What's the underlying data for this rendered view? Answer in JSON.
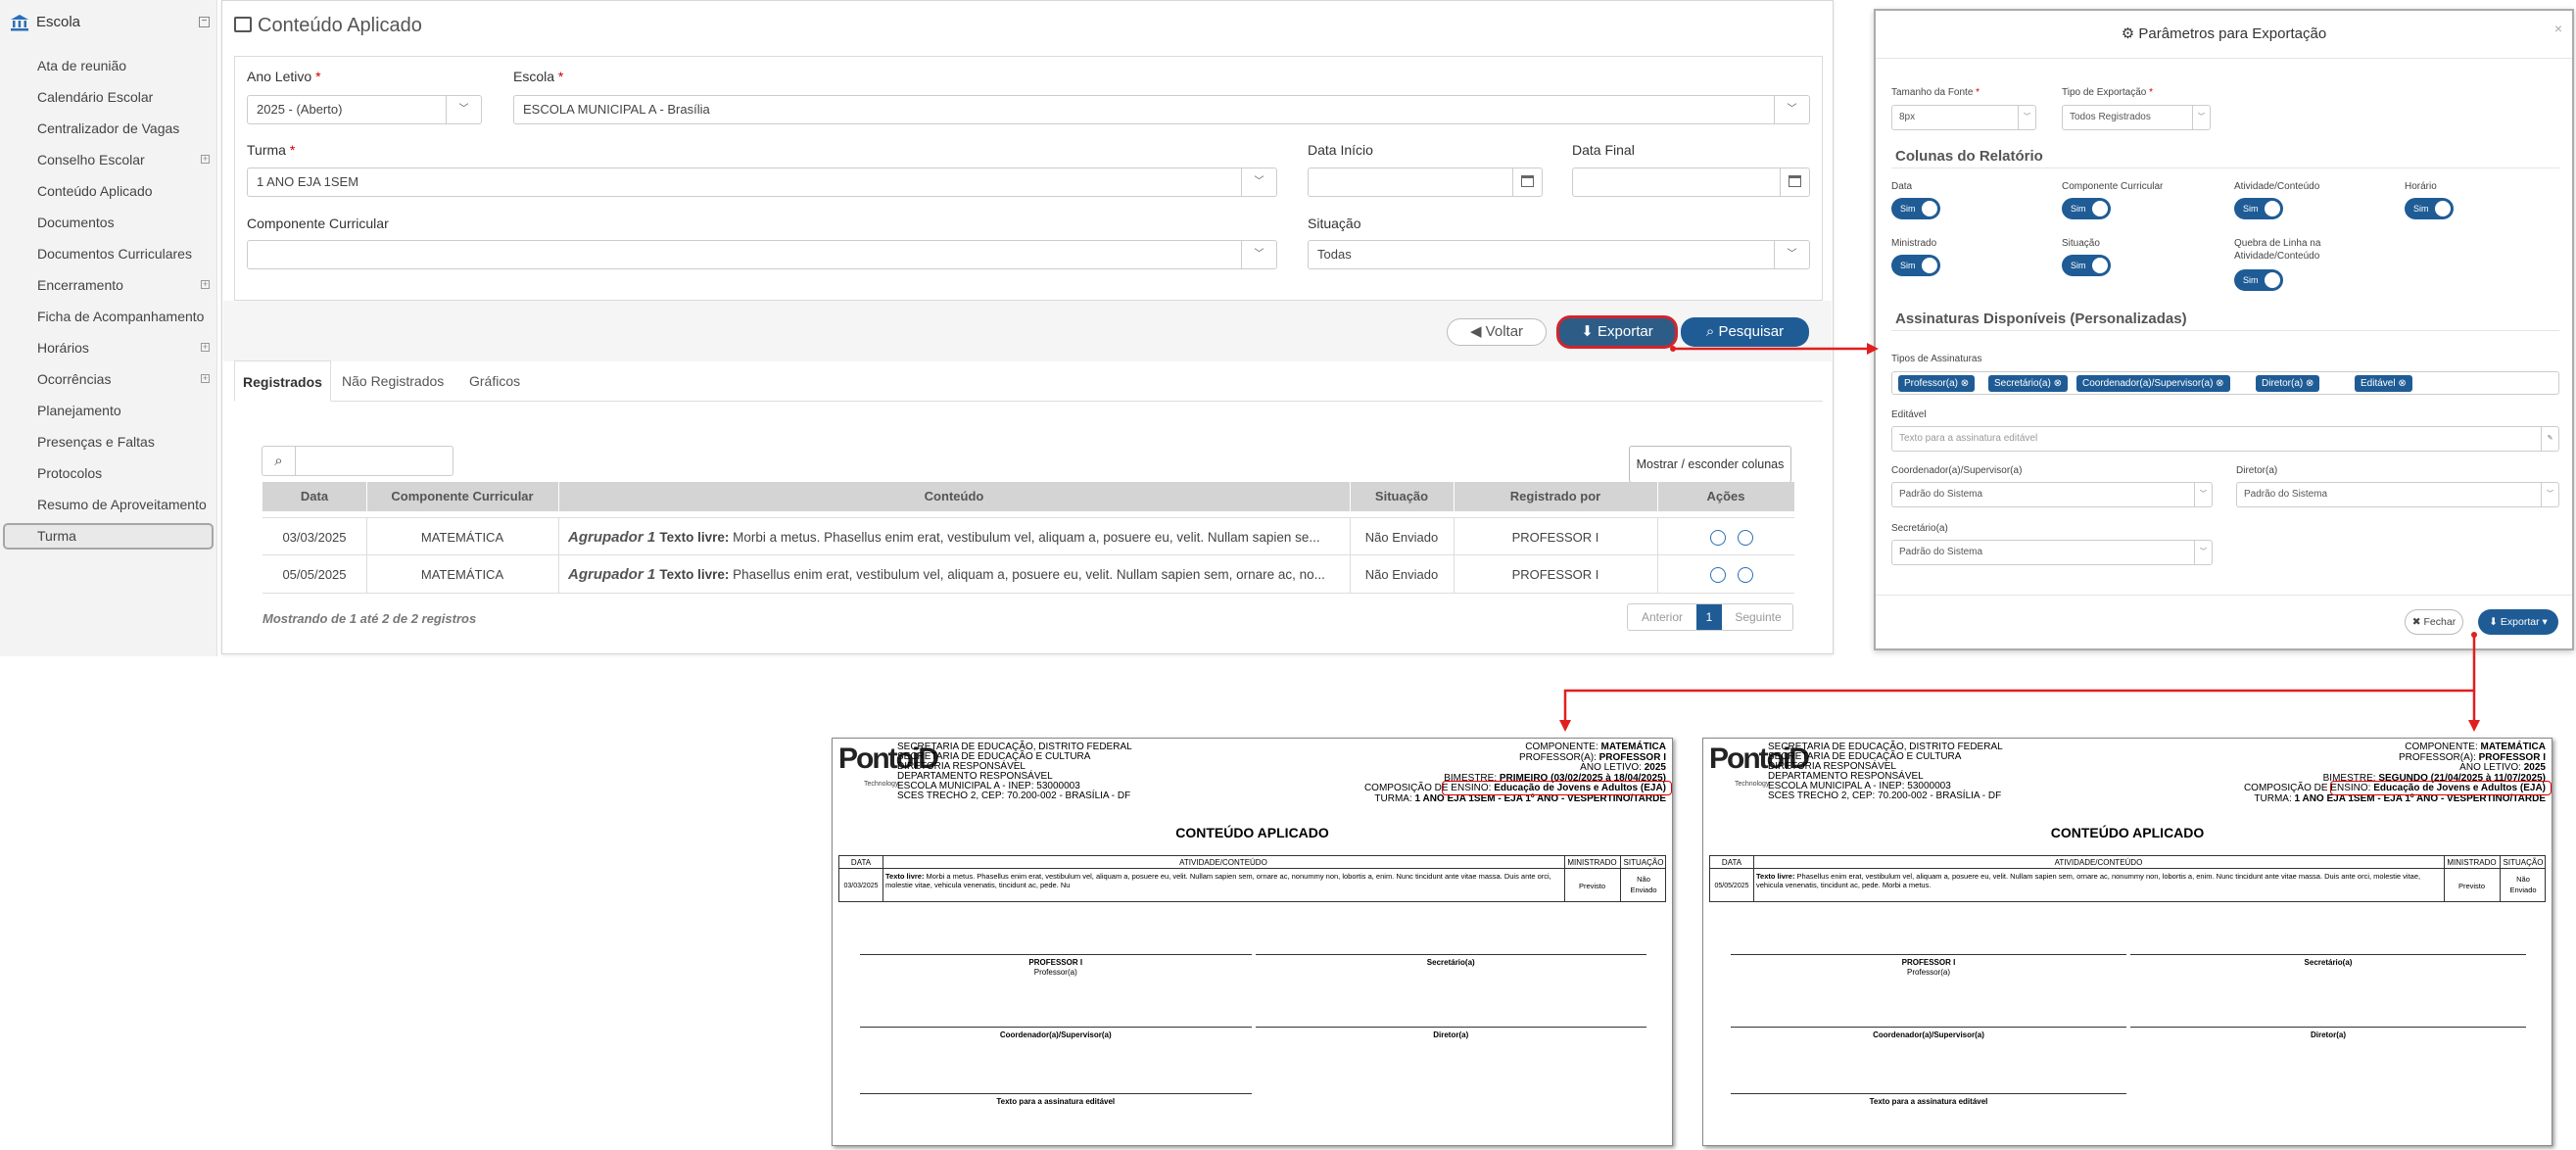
{
  "sidebar": {
    "header": "Escola",
    "items": [
      {
        "label": "Ata de reunião",
        "expandable": false
      },
      {
        "label": "Calendário Escolar",
        "expandable": false
      },
      {
        "label": "Centralizador de Vagas",
        "expandable": false
      },
      {
        "label": "Conselho Escolar",
        "expandable": true
      },
      {
        "label": "Conteúdo Aplicado",
        "expandable": false
      },
      {
        "label": "Documentos",
        "expandable": false
      },
      {
        "label": "Documentos Curriculares",
        "expandable": false
      },
      {
        "label": "Encerramento",
        "expandable": true
      },
      {
        "label": "Ficha de Acompanhamento",
        "expandable": false
      },
      {
        "label": "Horários",
        "expandable": true
      },
      {
        "label": "Ocorrências",
        "expandable": true
      },
      {
        "label": "Planejamento",
        "expandable": false
      },
      {
        "label": "Presenças e Faltas",
        "expandable": false
      },
      {
        "label": "Protocolos",
        "expandable": false
      },
      {
        "label": "Resumo de Aproveitamento",
        "expandable": false
      },
      {
        "label": "Turma",
        "expandable": false
      }
    ]
  },
  "main": {
    "title": "Conteúdo Aplicado",
    "form": {
      "ano_letivo_label": "Ano Letivo",
      "ano_letivo_value": "2025 - (Aberto)",
      "escola_label": "Escola",
      "escola_value": "ESCOLA MUNICIPAL A - Brasília",
      "turma_label": "Turma",
      "turma_value": "1 ANO EJA 1SEM",
      "data_inicio_label": "Data Início",
      "data_final_label": "Data Final",
      "componente_label": "Componente Curricular",
      "componente_value": "",
      "situacao_label": "Situação",
      "situacao_value": "Todas",
      "required_mark": "*"
    },
    "buttons": {
      "voltar": "Voltar",
      "exportar": "Exportar",
      "pesquisar": "Pesquisar"
    },
    "tabs": [
      "Registrados",
      "Não Registrados",
      "Gráficos"
    ],
    "toggle_columns": "Mostrar / esconder colunas",
    "table": {
      "headers": [
        "Data",
        "Componente Curricular",
        "Conteúdo",
        "Situação",
        "Registrado por",
        "Ações"
      ],
      "rows": [
        {
          "data": "03/03/2025",
          "componente": "MATEMÁTICA",
          "agrupador": "Agrupador 1",
          "texto_label": "Texto livre:",
          "conteudo": "Morbi a metus. Phasellus enim erat, vestibulum vel, aliquam a, posuere eu, velit. Nullam sapien se...",
          "situacao": "Não Enviado",
          "registrado": "PROFESSOR I"
        },
        {
          "data": "05/05/2025",
          "componente": "MATEMÁTICA",
          "agrupador": "Agrupador 1",
          "texto_label": "Texto livre:",
          "conteudo": "Phasellus enim erat, vestibulum vel, aliquam a, posuere eu, velit. Nullam sapien sem, ornare ac, no...",
          "situacao": "Não Enviado",
          "registrado": "PROFESSOR I"
        }
      ]
    },
    "footer_info": "Mostrando de 1 até 2 de 2 registros",
    "pagination": {
      "prev": "Anterior",
      "current": "1",
      "next": "Seguinte"
    }
  },
  "dialog": {
    "title": "Parâmetros para Exportação",
    "close": "×",
    "tamanho_label": "Tamanho da Fonte",
    "tamanho_value": "8px",
    "tipo_label": "Tipo de Exportação",
    "tipo_value": "Todos Registrados",
    "colunas_heading": "Colunas do Relatório",
    "colunas": [
      {
        "label": "Data",
        "value": "Sim"
      },
      {
        "label": "Componente Curricular",
        "value": "Sim"
      },
      {
        "label": "Atividade/Conteúdo",
        "value": "Sim"
      },
      {
        "label": "Horário",
        "value": "Sim"
      },
      {
        "label": "Ministrado",
        "value": "Sim"
      },
      {
        "label": "Situação",
        "value": "Sim"
      },
      {
        "label": "Quebra de Linha na",
        "label2": "Atividade/Conteúdo",
        "value": "Sim"
      }
    ],
    "assinaturas_heading": "Assinaturas Disponíveis (Personalizadas)",
    "tipos_label": "Tipos de Assinaturas",
    "tags": [
      "Professor(a)",
      "Secretário(a)",
      "Coordenador(a)/Supervisor(a)",
      "Diretor(a)",
      "Editável"
    ],
    "editavel_label": "Editável",
    "editavel_placeholder": "Texto para a assinatura editável",
    "coord_label": "Coordenador(a)/Supervisor(a)",
    "coord_value": "Padrão do Sistema",
    "diretor_label": "Diretor(a)",
    "diretor_value": "Padrão do Sistema",
    "secretario_label": "Secretário(a)",
    "secretario_value": "Padrão do Sistema",
    "fechar": "Fechar",
    "exportar": "Exportar"
  },
  "reports": [
    {
      "logo": "PontoiD",
      "logo_sub": "Technology",
      "header_left": [
        "SECRETARIA DE EDUCAÇÃO, DISTRITO FEDERAL",
        "SECRETARIA DE EDUCAÇÃO E CULTURA",
        "DIRETORIA RESPONSÁVEL",
        "DEPARTAMENTO RESPONSÁVEL",
        "ESCOLA MUNICIPAL A - INEP: 53000003",
        "SCES TRECHO 2, CEP: 70.200-002 - BRASÍLIA - DF"
      ],
      "right": [
        {
          "k": "COMPONENTE:",
          "v": "MATEMÁTICA"
        },
        {
          "k": "PROFESSOR(A):",
          "v": "PROFESSOR I"
        },
        {
          "k": "ANO LETIVO:",
          "v": "2025"
        },
        {
          "k": "BIMESTRE:",
          "v": "PRIMEIRO (03/02/2025 à 18/04/2025)"
        },
        {
          "k": "COMPOSIÇÃO DE ENSINO:",
          "v": "Educação de Jovens e Adultos (EJA)"
        },
        {
          "k": "TURMA:",
          "v": "1 ANO EJA 1SEM - EJA 1º ANO - VESPERTINO/TARDE"
        }
      ],
      "title": "CONTEÚDO APLICADO",
      "cols": [
        "DATA",
        "ATIVIDADE/CONTEÚDO",
        "MINISTRADO",
        "SITUAÇÃO"
      ],
      "row": {
        "data": "03/03/2025",
        "label": "Texto livre:",
        "text": "Morbi a metus. Phasellus enim erat, vestibulum vel, aliquam a, posuere eu, velit. Nullam sapien sem, ornare ac, nonummy non, lobortis a, enim. Nunc tincidunt ante vitae massa. Duis ante orci, molestie vitae, vehicula venenatis, tincidunt ac, pede. Nu",
        "ministrado": "Previsto",
        "situacao1": "Não",
        "situacao2": "Enviado"
      },
      "sigs": {
        "prof_name": "PROFESSOR I",
        "prof": "Professor(a)",
        "sec": "Secretário(a)",
        "coord": "Coordenador(a)/Supervisor(a)",
        "dir": "Diretor(a)",
        "edit": "Texto para a assinatura editável"
      }
    },
    {
      "logo": "PontoiD",
      "logo_sub": "Technology",
      "header_left": [
        "SECRETARIA DE EDUCAÇÃO, DISTRITO FEDERAL",
        "SECRETARIA DE EDUCAÇÃO E CULTURA",
        "DIRETORIA RESPONSÁVEL",
        "DEPARTAMENTO RESPONSÁVEL",
        "ESCOLA MUNICIPAL A - INEP: 53000003",
        "SCES TRECHO 2, CEP: 70.200-002 - BRASÍLIA - DF"
      ],
      "right": [
        {
          "k": "COMPONENTE:",
          "v": "MATEMÁTICA"
        },
        {
          "k": "PROFESSOR(A):",
          "v": "PROFESSOR I"
        },
        {
          "k": "ANO LETIVO:",
          "v": "2025"
        },
        {
          "k": "BIMESTRE:",
          "v": "SEGUNDO (21/04/2025 à 11/07/2025)"
        },
        {
          "k": "COMPOSIÇÃO DE ENSINO:",
          "v": "Educação de Jovens e Adultos (EJA)"
        },
        {
          "k": "TURMA:",
          "v": "1 ANO EJA 1SEM - EJA 1º ANO - VESPERTINO/TARDE"
        }
      ],
      "title": "CONTEÚDO APLICADO",
      "cols": [
        "DATA",
        "ATIVIDADE/CONTEÚDO",
        "MINISTRADO",
        "SITUAÇÃO"
      ],
      "row": {
        "data": "05/05/2025",
        "label": "Texto livre:",
        "text": "Phasellus enim erat, vestibulum vel, aliquam a, posuere eu, velit. Nullam sapien sem, ornare ac, nonummy non, lobortis a, enim. Nunc tincidunt ante vitae massa. Duis ante orci, molestie vitae, vehicula venenatis, tincidunt ac, pede. Morbi a metus.",
        "ministrado": "Previsto",
        "situacao1": "Não",
        "situacao2": "Enviado"
      },
      "sigs": {
        "prof_name": "PROFESSOR I",
        "prof": "Professor(a)",
        "sec": "Secretário(a)",
        "coord": "Coordenador(a)/Supervisor(a)",
        "dir": "Diretor(a)",
        "edit": "Texto para a assinatura editável"
      }
    }
  ],
  "colors": {
    "primary": "#1f5c96",
    "export_btn": "#2d5d86",
    "highlight": "#e01f1f",
    "sidebar_bg": "#f3f3f3"
  }
}
